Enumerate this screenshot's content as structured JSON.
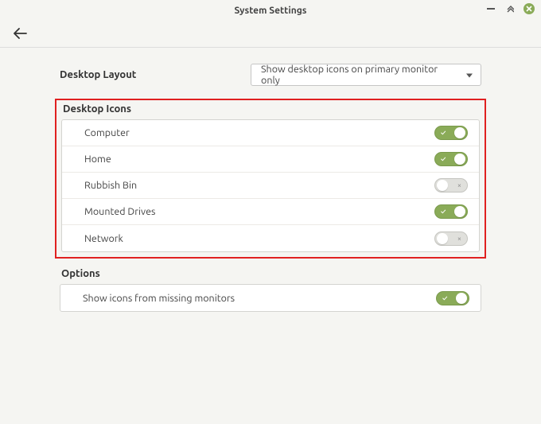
{
  "window": {
    "title": "System Settings"
  },
  "layout": {
    "label": "Desktop Layout",
    "selected": "Show desktop icons on primary monitor only"
  },
  "sections": {
    "icons": {
      "header": "Desktop Icons",
      "rows": [
        {
          "label": "Computer",
          "on": true
        },
        {
          "label": "Home",
          "on": true
        },
        {
          "label": "Rubbish Bin",
          "on": false
        },
        {
          "label": "Mounted Drives",
          "on": true
        },
        {
          "label": "Network",
          "on": false
        }
      ]
    },
    "options": {
      "header": "Options",
      "rows": [
        {
          "label": "Show icons from missing monitors",
          "on": true
        }
      ]
    }
  }
}
